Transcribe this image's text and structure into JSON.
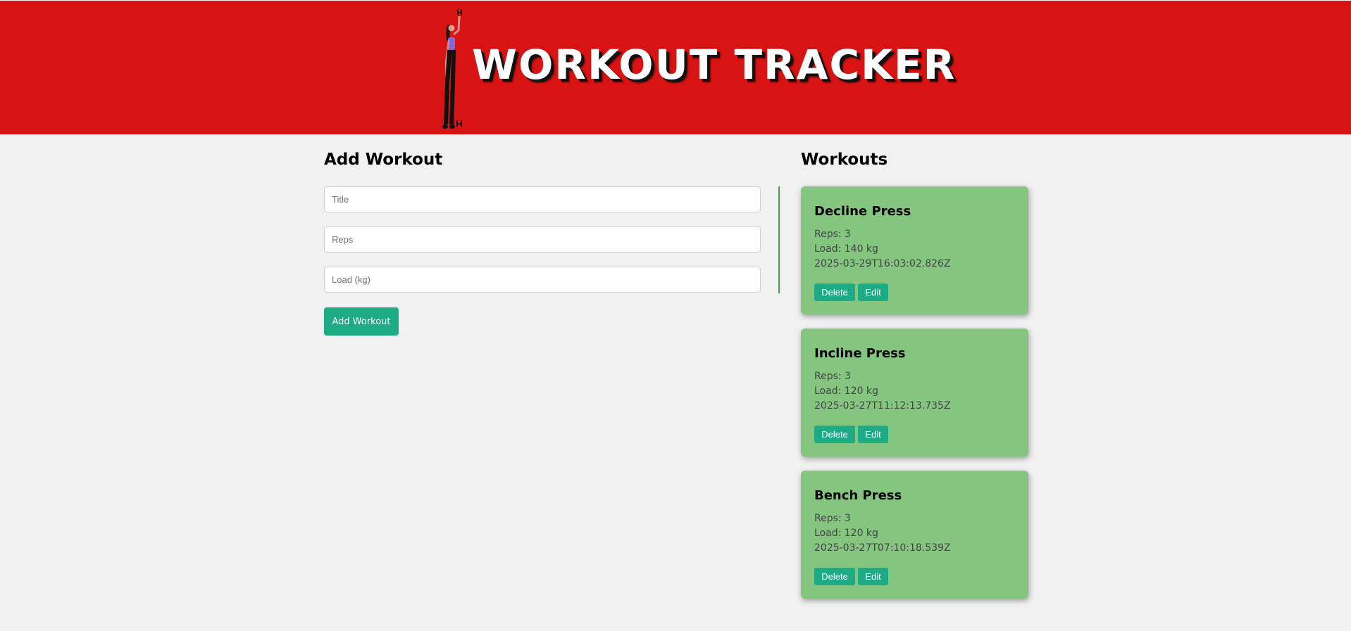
{
  "header": {
    "title": "WORKOUT TRACKER",
    "colors": {
      "background": "#d71313",
      "text": "#ffffff"
    }
  },
  "form": {
    "heading": "Add Workout",
    "title_placeholder": "Title",
    "reps_placeholder": "Reps",
    "load_placeholder": "Load (kg)",
    "submit_label": "Add Workout"
  },
  "list": {
    "heading": "Workouts",
    "workouts": [
      {
        "title": "Decline Press",
        "reps": "Reps: 3",
        "load": "Load: 140 kg",
        "created": "2025-03-29T16:03:02.826Z",
        "delete_label": "Delete",
        "edit_label": "Edit"
      },
      {
        "title": "Incline Press",
        "reps": "Reps: 3",
        "load": "Load: 120 kg",
        "created": "2025-03-27T11:12:13.735Z",
        "delete_label": "Delete",
        "edit_label": "Edit"
      },
      {
        "title": "Bench Press",
        "reps": "Reps: 3",
        "load": "Load: 120 kg",
        "created": "2025-03-27T07:10:18.539Z",
        "delete_label": "Delete",
        "edit_label": "Edit"
      }
    ]
  },
  "colors": {
    "accent": "#1cab84",
    "card": "#84c580",
    "page": "#f1f1f1"
  }
}
